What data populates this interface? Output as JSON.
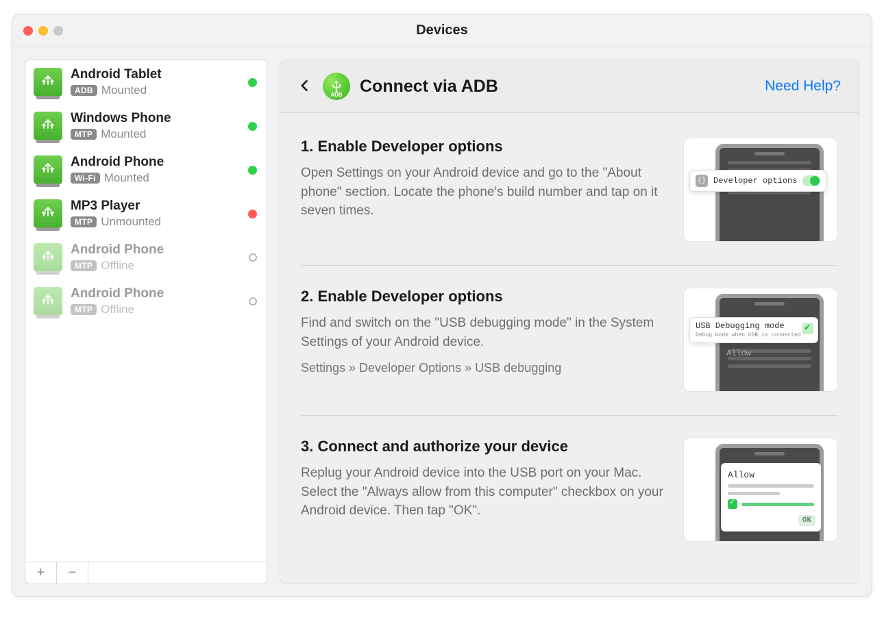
{
  "window": {
    "title": "Devices"
  },
  "sidebar": {
    "devices": [
      {
        "name": "Android Tablet",
        "badge": "ADB",
        "status": "Mounted",
        "dot": "green",
        "dim": false
      },
      {
        "name": "Windows Phone",
        "badge": "MTP",
        "status": "Mounted",
        "dot": "green",
        "dim": false
      },
      {
        "name": "Android Phone",
        "badge": "Wi-Fi",
        "status": "Mounted",
        "dot": "green",
        "dim": false
      },
      {
        "name": "MP3 Player",
        "badge": "MTP",
        "status": "Unmounted",
        "dot": "red",
        "dim": false
      },
      {
        "name": "Android Phone",
        "badge": "MTP",
        "status": "Offline",
        "dot": "hollow",
        "dim": true
      },
      {
        "name": "Android Phone",
        "badge": "MTP",
        "status": "Offline",
        "dot": "hollow",
        "dim": true
      }
    ],
    "footer": {
      "add": "+",
      "remove": "−"
    }
  },
  "main": {
    "header": {
      "title": "Connect via ADB",
      "help": "Need Help?",
      "adb_label": "ADB"
    },
    "steps": [
      {
        "title": "1. Enable Developer options",
        "desc": "Open Settings on your Android device and go to the \"About phone\" section. Locate the phone's build number and tap on it seven times.",
        "path": "",
        "pill": {
          "text": "Developer options"
        }
      },
      {
        "title": "2. Enable Developer options",
        "desc": "Find and switch on the \"USB debugging mode\" in the System Settings of your Android device.",
        "path": "Settings » Developer Options » USB debugging",
        "pill": {
          "text": "USB Debugging mode",
          "sub": "Debug mode when USB is connected"
        },
        "allow_label": "Allow"
      },
      {
        "title": "3. Connect and authorize your device",
        "desc": "Replug your Android device into the USB port on your Mac. Select the \"Always allow from this computer\" checkbox on your Android device. Then tap \"OK\".",
        "path": "",
        "allow_label": "Allow",
        "ok_label": "OK"
      }
    ]
  }
}
